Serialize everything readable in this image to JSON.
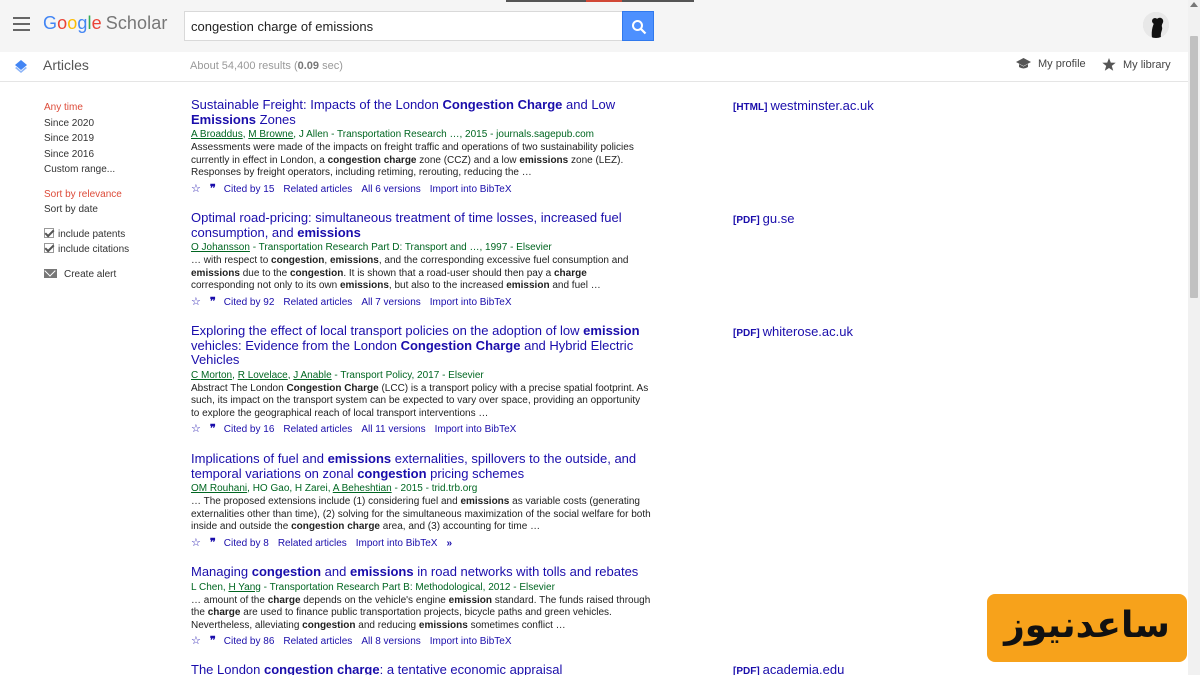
{
  "header": {
    "logo_google": [
      "G",
      "o",
      "o",
      "g",
      "l",
      "e"
    ],
    "logo_scholar": "Scholar",
    "search_value": "congestion charge of emissions"
  },
  "subbar": {
    "section": "Articles",
    "results_prefix": "About 54,400 results (",
    "results_time": "0.09",
    "results_suffix": " sec)",
    "my_profile": "My profile",
    "my_library": "My library"
  },
  "sidebar": {
    "time": [
      "Any time",
      "Since 2020",
      "Since 2019",
      "Since 2016",
      "Custom range..."
    ],
    "sort": [
      "Sort by relevance",
      "Sort by date"
    ],
    "include_patents": "include patents",
    "include_citations": "include citations",
    "create_alert": "Create alert"
  },
  "results": [
    {
      "title": [
        "Sustainable Freight: Impacts of the London ",
        {
          "b": "Congestion Charge"
        },
        " and Low ",
        {
          "b": "Emissions"
        },
        " Zones"
      ],
      "authors": [
        {
          "u": "A Broaddus"
        },
        ", ",
        {
          "u": "M Browne"
        },
        ", J Allen - Transportation Research …, 2015 - journals.sagepub.com"
      ],
      "snippet": [
        "Assessments were made of the impacts on freight traffic and operations of two sustainability policies currently in effect in London, a ",
        {
          "b": "congestion charge"
        },
        " zone (CCZ) and a low ",
        {
          "b": "emissions"
        },
        " zone (LEZ). Responses by freight operators, including retiming, rerouting, reducing the …"
      ],
      "links": [
        "Cited by 15",
        "Related articles",
        "All 6 versions",
        "Import into BibTeX"
      ],
      "side_type": "[HTML]",
      "side_domain": "westminster.ac.uk"
    },
    {
      "title": [
        "Optimal road-pricing: simultaneous treatment of time losses, increased fuel consumption, and ",
        {
          "b": "emissions"
        }
      ],
      "authors": [
        {
          "u": "O Johansson"
        },
        " - Transportation Research Part D: Transport and …, 1997 - Elsevier"
      ],
      "snippet": [
        "… with respect to ",
        {
          "b": "congestion"
        },
        ", ",
        {
          "b": "emissions"
        },
        ", and the corresponding excessive fuel consumption and ",
        {
          "b": "emissions"
        },
        " due to the ",
        {
          "b": "congestion"
        },
        ". It is shown that a road-user should then pay a ",
        {
          "b": "charge"
        },
        " corresponding not only to its own ",
        {
          "b": "emissions"
        },
        ", but also to the increased ",
        {
          "b": "emission"
        },
        " and fuel …"
      ],
      "links": [
        "Cited by 92",
        "Related articles",
        "All 7 versions",
        "Import into BibTeX"
      ],
      "side_type": "[PDF]",
      "side_domain": "gu.se"
    },
    {
      "title": [
        "Exploring the effect of local transport policies on the adoption of low ",
        {
          "b": "emission"
        },
        " vehicles: Evidence from the London ",
        {
          "b": "Congestion Charge"
        },
        " and Hybrid Electric Vehicles"
      ],
      "authors": [
        {
          "u": "C Morton"
        },
        ", ",
        {
          "u": "R Lovelace"
        },
        ", ",
        {
          "u": "J Anable"
        },
        " - Transport Policy, 2017 - Elsevier"
      ],
      "snippet": [
        "Abstract The London ",
        {
          "b": "Congestion Charge"
        },
        " (LCC) is a transport policy with a precise spatial footprint. As such, its impact on the transport system can be expected to vary over space, providing an opportunity to explore the geographical reach of local transport interventions …"
      ],
      "links": [
        "Cited by 16",
        "Related articles",
        "All 11 versions",
        "Import into BibTeX"
      ],
      "side_type": "[PDF]",
      "side_domain": "whiterose.ac.uk"
    },
    {
      "title": [
        "Implications of fuel and ",
        {
          "b": "emissions"
        },
        " externalities, spillovers to the outside, and temporal variations on zonal ",
        {
          "b": "congestion"
        },
        " pricing schemes"
      ],
      "authors": [
        {
          "u": "OM Rouhani"
        },
        ", HO Gao, H Zarei, ",
        {
          "u": "A Beheshtian"
        },
        " - 2015 - trid.trb.org"
      ],
      "snippet": [
        "… The proposed extensions include (1) considering fuel and ",
        {
          "b": "emissions"
        },
        " as variable costs (generating externalities other than time), (2) solving for the simultaneous maximization of the social welfare for both inside and outside the ",
        {
          "b": "congestion charge"
        },
        " area, and (3) accounting for time …"
      ],
      "links": [
        "Cited by 8",
        "Related articles",
        "Import into BibTeX"
      ],
      "side_type": "",
      "side_domain": ""
    },
    {
      "title": [
        "Managing ",
        {
          "b": "congestion"
        },
        " and ",
        {
          "b": "emissions"
        },
        " in road networks with tolls and rebates"
      ],
      "authors": [
        "L Chen, ",
        {
          "u": "H Yang"
        },
        " - Transportation Research Part B: Methodological, 2012 - Elsevier"
      ],
      "snippet": [
        "… amount of the ",
        {
          "b": "charge"
        },
        " depends on the vehicle's engine ",
        {
          "b": "emission"
        },
        " standard. The funds raised through the ",
        {
          "b": "charge"
        },
        " are used to finance public transportation projects, bicycle paths and green vehicles. Nevertheless, alleviating ",
        {
          "b": "congestion"
        },
        " and reducing ",
        {
          "b": "emissions"
        },
        " sometimes conflict …"
      ],
      "links": [
        "Cited by 86",
        "Related articles",
        "All 8 versions",
        "Import into BibTeX"
      ],
      "side_type": "",
      "side_domain": ""
    },
    {
      "title": [
        "The London ",
        {
          "b": "congestion charge"
        },
        ": a tentative economic appraisal"
      ],
      "authors": [],
      "snippet": [],
      "links": [],
      "side_type": "[PDF]",
      "side_domain": "academia.edu"
    }
  ],
  "watermark": "ساعدنیوز",
  "colors": {
    "link": "#1a0dab",
    "authors": "#006621",
    "active": "#dd4b39",
    "search_button": "#4d90fe"
  }
}
